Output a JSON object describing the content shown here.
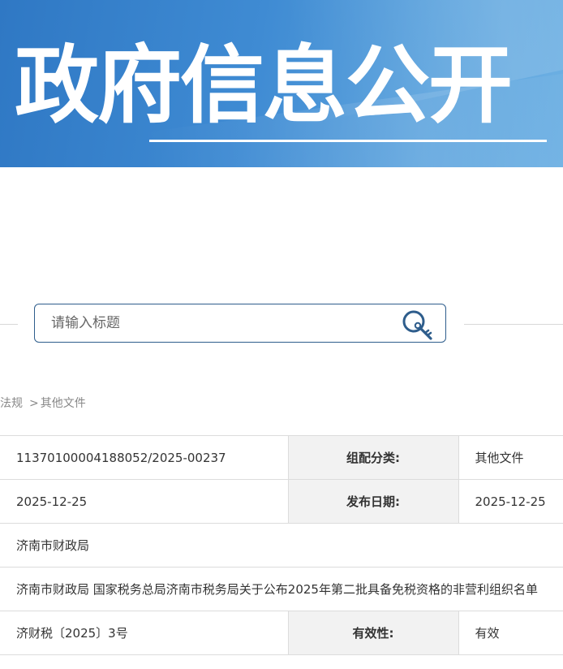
{
  "banner": {
    "title": "政府信息公开"
  },
  "search": {
    "placeholder": "请输入标题",
    "value": ""
  },
  "breadcrumb": {
    "items": [
      "法规",
      "其他文件"
    ],
    "separator": ">"
  },
  "info": {
    "index_no": "11370100004188052/2025-00237",
    "category_label": "组配分类:",
    "category_value": "其他文件",
    "date_value": "2025-12-25",
    "publish_date_label": "发布日期:",
    "publish_date_value": "2025-12-25",
    "issuer": "济南市财政局",
    "title": "济南市财政局 国家税务总局济南市税务局关于公布2025年第二批具备免税资格的非营利组织名单",
    "doc_no": "济财税〔2025〕3号",
    "validity_label": "有效性:",
    "validity_value": "有效"
  },
  "colors": {
    "banner_blue": "#3a86cf",
    "search_border": "#2e5d8c",
    "label_bg": "#f2f2f2"
  },
  "icons": {
    "search": "search-key-icon"
  }
}
